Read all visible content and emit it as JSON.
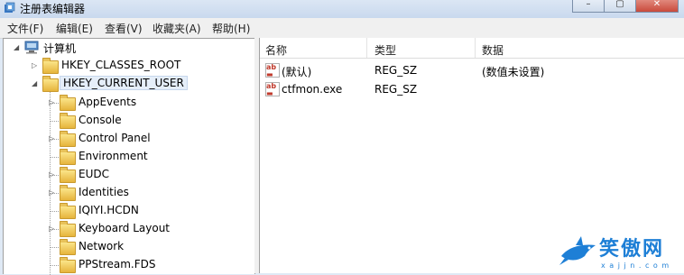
{
  "window": {
    "title": "注册表编辑器"
  },
  "menu": [
    "文件(F)",
    "编辑(E)",
    "查看(V)",
    "收藏夹(A)",
    "帮助(H)"
  ],
  "tree": {
    "root": "计算机",
    "hives": [
      "HKEY_CLASSES_ROOT",
      "HKEY_CURRENT_USER"
    ],
    "subkeys": [
      "AppEvents",
      "Console",
      "Control Panel",
      "Environment",
      "EUDC",
      "Identities",
      "IQIYI.HCDN",
      "Keyboard Layout",
      "Network",
      "PPStream.FDS"
    ]
  },
  "values": {
    "columns": [
      "名称",
      "类型",
      "数据"
    ],
    "rows": [
      {
        "name": "(默认)",
        "type": "REG_SZ",
        "data": "(数值未设置)"
      },
      {
        "name": "ctfmon.exe",
        "type": "REG_SZ",
        "data": ""
      }
    ]
  },
  "watermark": {
    "text": "笑傲网",
    "url": "x a j j n . c o m"
  },
  "colors": {
    "accent": "#1e7fd6",
    "folder": "#f2c94c",
    "selection": "#e5eef9"
  }
}
